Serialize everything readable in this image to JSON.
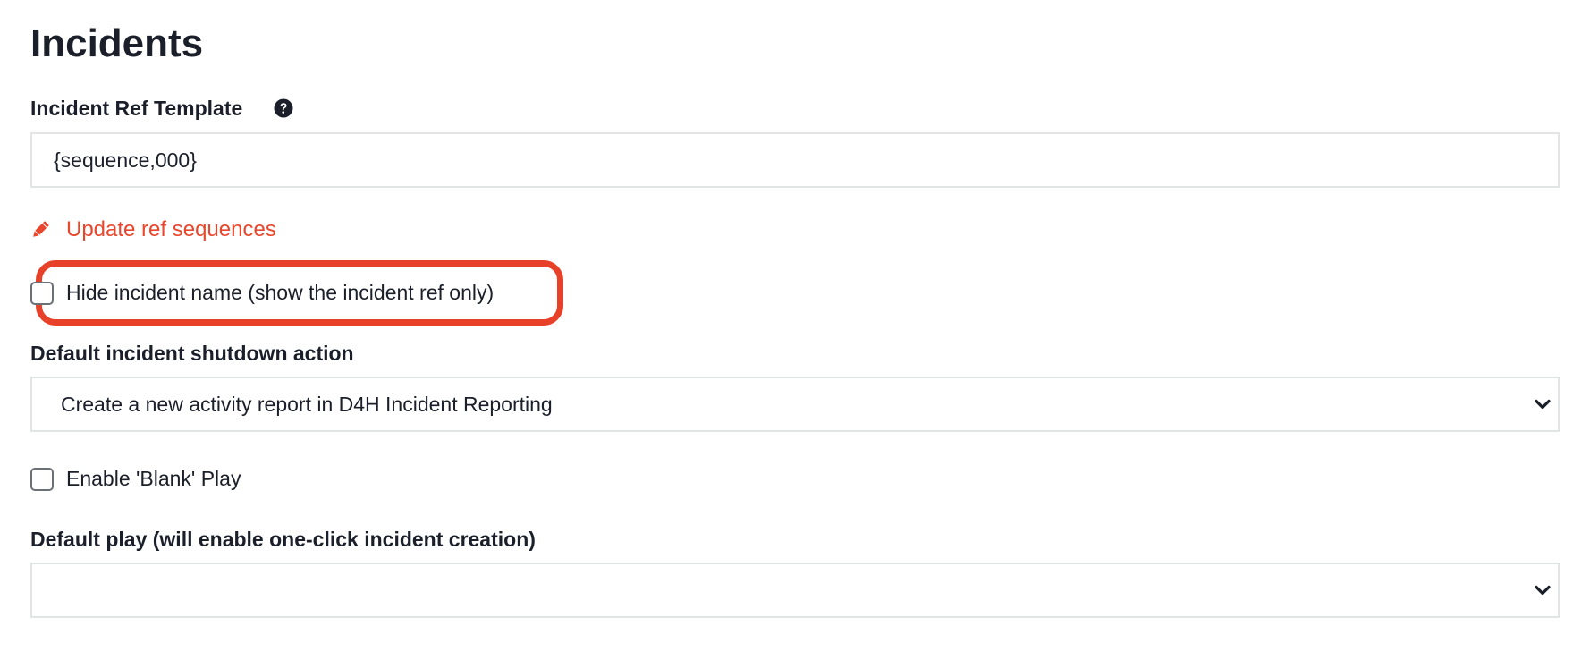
{
  "page": {
    "title": "Incidents"
  },
  "ref_template": {
    "label": "Incident Ref Template",
    "help_icon": "question-circle-icon",
    "value": "{sequence,000}"
  },
  "update_sequences": {
    "icon": "pencil-icon",
    "label": "Update ref sequences",
    "color": "#e8472d"
  },
  "hide_name": {
    "label": "Hide incident name (show the incident ref only)",
    "checked": false,
    "highlight_color": "#e8412a"
  },
  "shutdown_action": {
    "label": "Default incident shutdown action",
    "selected": "Create a new activity report in D4H Incident Reporting"
  },
  "blank_play": {
    "label": "Enable 'Blank' Play",
    "checked": false
  },
  "default_play": {
    "label": "Default play (will enable one-click incident creation)",
    "selected": ""
  }
}
